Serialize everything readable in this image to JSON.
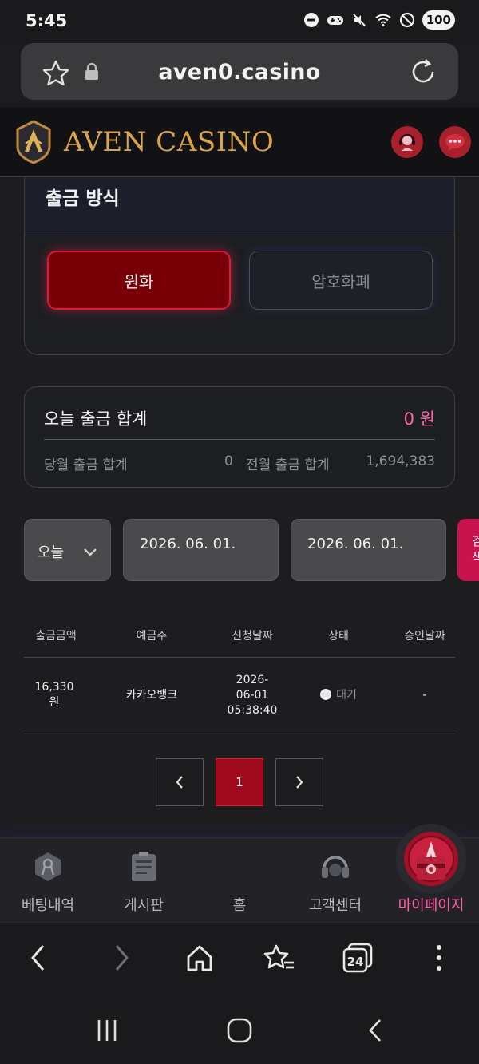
{
  "status_bar": {
    "time": "5:45",
    "battery": "100"
  },
  "browser": {
    "url": "aven0.casino"
  },
  "site": {
    "brand": "AVEN CASINO"
  },
  "withdraw_method": {
    "title": "출금 방식",
    "options": [
      {
        "label": "원화",
        "selected": true
      },
      {
        "label": "암호화폐",
        "selected": false
      }
    ]
  },
  "summary": {
    "today_label": "오늘 출금 합계",
    "today_value": "0 원",
    "month_label": "당월 출금 합계",
    "month_value": "0",
    "prev_month_label": "전월 출금 합계",
    "prev_month_value": "1,694,383"
  },
  "filter": {
    "period": "오늘",
    "start_date": "2026. 06. 01.",
    "end_date": "2026. 06. 01.",
    "search_label": "검색"
  },
  "table": {
    "headers": [
      "출금금액",
      "예금주",
      "신청날짜",
      "상태",
      "승인날짜"
    ],
    "rows": [
      {
        "amount_line1": "16,330",
        "amount_line2": "원",
        "holder": "카카오뱅크",
        "date_line1": "2026-",
        "date_line2": "06-01",
        "date_line3": "05:38:40",
        "status": "대기",
        "approved": "-"
      }
    ]
  },
  "pagination": {
    "current": "1"
  },
  "bottom_nav": {
    "items": [
      {
        "label": "베팅내역",
        "icon": "ribbon-icon"
      },
      {
        "label": "게시판",
        "icon": "board-icon"
      },
      {
        "label": "홈",
        "icon": "home-emblem-icon"
      },
      {
        "label": "고객센터",
        "icon": "headset-icon"
      },
      {
        "label": "마이페이지",
        "icon": "mypage-icon",
        "active": true
      }
    ]
  },
  "browser_nav": {
    "tabs_count": "24"
  },
  "colors": {
    "accent": "#c8134f",
    "brand_gold": "#d9a64a",
    "active_pink": "#ff5ea8"
  }
}
